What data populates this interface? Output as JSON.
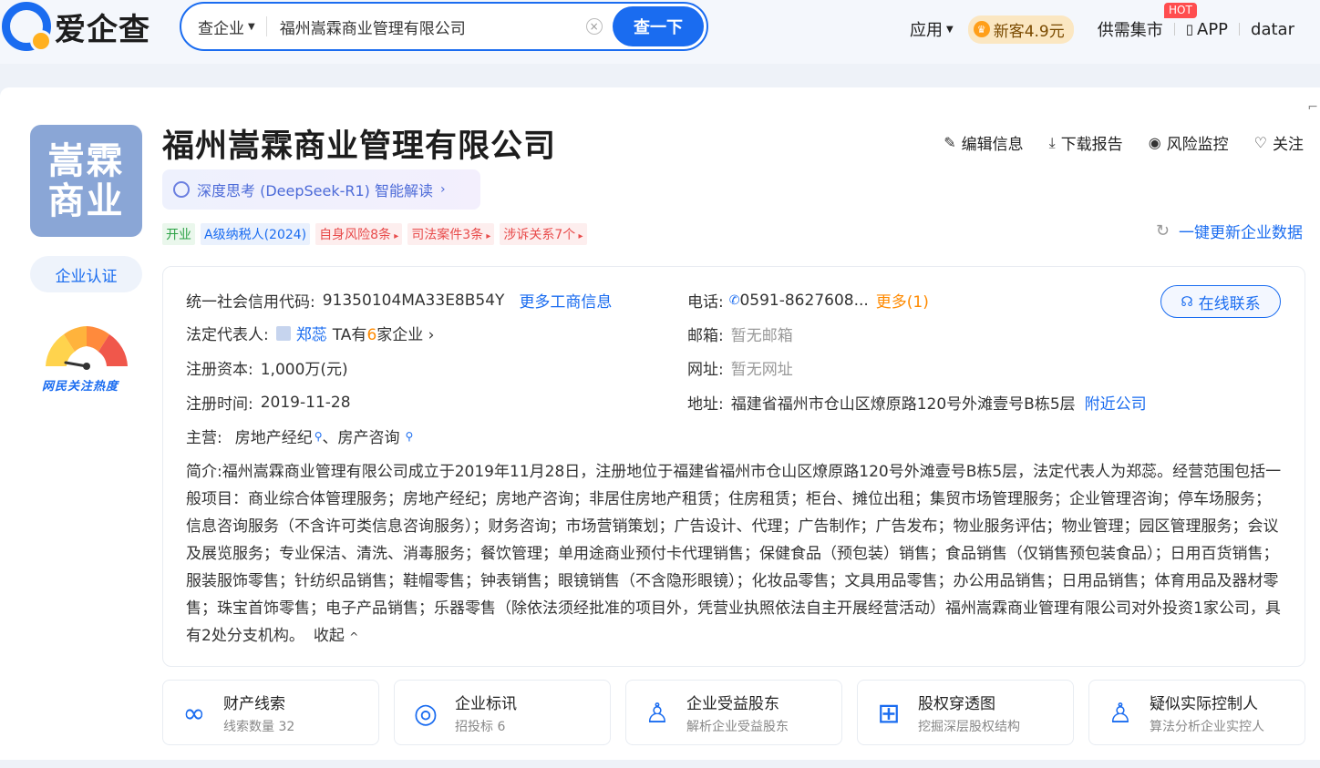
{
  "header": {
    "logo_text": "爱企查",
    "search_type": "查企业",
    "search_value": "福州嵩霖商业管理有限公司",
    "search_button": "查一下",
    "nav": {
      "apps": "应用",
      "vip": "新客4.9元",
      "market": "供需集市",
      "hot": "HOT",
      "app": "APP",
      "data": "datar"
    }
  },
  "company": {
    "avatar_line1": "嵩霖",
    "avatar_line2": "商业",
    "name": "福州嵩霖商业管理有限公司",
    "certify": "企业认证",
    "heat_label": "网民关注热度",
    "ai_label": "深度思考 (DeepSeek-R1) 智能解读",
    "actions": {
      "edit": "编辑信息",
      "download": "下载报告",
      "monitor": "风险监控",
      "follow": "关注"
    },
    "tags": [
      {
        "text": "开业",
        "type": "green"
      },
      {
        "text": "A级纳税人(2024)",
        "type": "blue"
      },
      {
        "text": "自身风险8条",
        "type": "red"
      },
      {
        "text": "司法案件3条",
        "type": "red"
      },
      {
        "text": "涉诉关系7个",
        "type": "red"
      }
    ],
    "refresh": "一键更新企业数据"
  },
  "info": {
    "credit_label": "统一社会信用代码:",
    "credit_value": "91350104MA33E8B54Y",
    "more_biz": "更多工商信息",
    "legal_label": "法定代表人:",
    "legal_value": "郑蕊",
    "legal_companies_pre": "TA有",
    "legal_companies_num": "6",
    "legal_companies_post": "家企业",
    "capital_label": "注册资本:",
    "capital_value": "1,000万(元)",
    "date_label": "注册时间:",
    "date_value": "2019-11-28",
    "biz_label": "主营:",
    "biz_item1": "房地产经纪",
    "biz_sep": "、",
    "biz_item2": "房产咨询",
    "phone_label": "电话:",
    "phone_value": "0591-8627608...",
    "phone_more": "更多(1)",
    "email_label": "邮箱:",
    "email_value": "暂无邮箱",
    "site_label": "网址:",
    "site_value": "暂无网址",
    "addr_label": "地址:",
    "addr_value": "福建省福州市仓山区燎原路120号外滩壹号B栋5层",
    "nearby": "附近公司",
    "contact": "在线联系",
    "intro_label": "简介:",
    "intro_text": "福州嵩霖商业管理有限公司成立于2019年11月28日，注册地位于福建省福州市仓山区燎原路120号外滩壹号B栋5层，法定代表人为郑蕊。经营范围包括一般项目：商业综合体管理服务；房地产经纪；房地产咨询；非居住房地产租赁；住房租赁；柜台、摊位出租；集贸市场管理服务；企业管理咨询；停车场服务；信息咨询服务（不含许可类信息咨询服务）；财务咨询；市场营销策划；广告设计、代理；广告制作；广告发布；物业服务评估；物业管理；园区管理服务；会议及展览服务；专业保洁、清洗、消毒服务；餐饮管理；单用途商业预付卡代理销售；保健食品（预包装）销售；食品销售（仅销售预包装食品）；日用百货销售；服装服饰零售；针纺织品销售；鞋帽零售；钟表销售；眼镜销售（不含隐形眼镜）；化妆品零售；文具用品零售；办公用品销售；日用品销售；体育用品及器材零售；珠宝首饰零售；电子产品销售；乐器零售（除依法须经批准的项目外，凭营业执照依法自主开展经营活动）福州嵩霖商业管理有限公司对外投资1家公司，具有2处分支机构。",
    "collapse": "收起"
  },
  "cards": [
    {
      "title": "财产线索",
      "sub": "线索数量 32",
      "icon": "asset-icon"
    },
    {
      "title": "企业标讯",
      "sub": "招投标 6",
      "icon": "target-icon"
    },
    {
      "title": "企业受益股东",
      "sub": "解析企业受益股东",
      "icon": "beneficiary-icon"
    },
    {
      "title": "股权穿透图",
      "sub": "挖掘深层股权结构",
      "icon": "org-chart-icon"
    },
    {
      "title": "疑似实际控制人",
      "sub": "算法分析企业实控人",
      "icon": "controller-icon"
    }
  ]
}
